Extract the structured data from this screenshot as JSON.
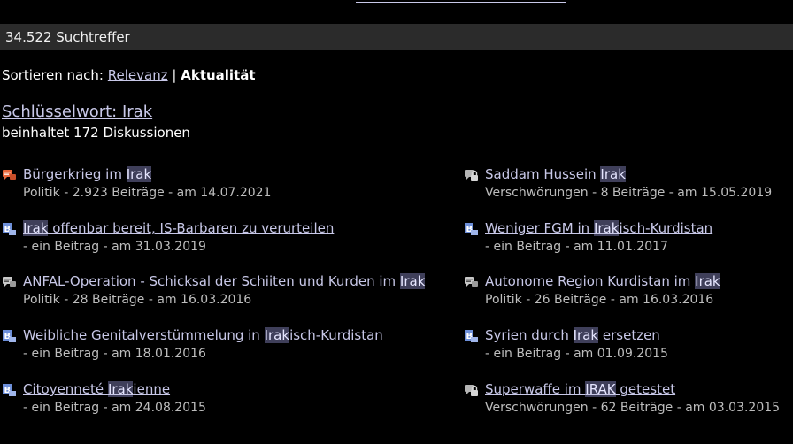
{
  "header": {
    "count_text": "34.522 Suchtreffer"
  },
  "sort": {
    "label": "Sortieren nach:",
    "relevance": "Relevanz",
    "separator": "|",
    "current": "Aktualität"
  },
  "keyword": {
    "title": "Schlüsselwort: Irak",
    "subtitle": "beinhaltet 172 Diskussionen"
  },
  "results": [
    {
      "icon": "discussion-hot-icon",
      "title_pre": "Bürgerkrieg im ",
      "title_hl": "Irak",
      "title_post": "",
      "meta": "Politik - 2.923 Beiträge - am 14.07.2021"
    },
    {
      "icon": "locked-discussion-icon",
      "title_pre": "Saddam Hussein ",
      "title_hl": "Irak",
      "title_post": "",
      "meta": "Verschwörungen - 8 Beiträge - am 15.05.2019"
    },
    {
      "icon": "blog-icon",
      "title_pre": "",
      "title_hl": "Irak",
      "title_post": " offenbar bereit, IS-Barbaren zu verurteilen",
      "meta": "- ein Beitrag - am 31.03.2019"
    },
    {
      "icon": "blog-icon",
      "title_pre": "Weniger FGM in ",
      "title_hl": "Irak",
      "title_post": "isch-Kurdistan",
      "meta": "- ein Beitrag - am 11.01.2017"
    },
    {
      "icon": "discussion-icon",
      "title_pre": "ANFAL-Operation - Schicksal der Schiiten und Kurden im ",
      "title_hl": "Irak",
      "title_post": "",
      "meta": "Politik - 28 Beiträge - am 16.03.2016"
    },
    {
      "icon": "discussion-icon",
      "title_pre": "Autonome Region Kurdistan im ",
      "title_hl": "Irak",
      "title_post": "",
      "meta": "Politik - 26 Beiträge - am 16.03.2016"
    },
    {
      "icon": "blog-icon",
      "title_pre": "Weibliche Genitalverstümmelung in ",
      "title_hl": "Irak",
      "title_post": "isch-Kurdistan",
      "meta": "- ein Beitrag - am 18.01.2016"
    },
    {
      "icon": "blog-icon",
      "title_pre": "Syrien durch ",
      "title_hl": "Irak",
      "title_post": " ersetzen",
      "meta": "- ein Beitrag - am 01.09.2015"
    },
    {
      "icon": "blog-icon",
      "title_pre": "Citoyenneté ",
      "title_hl": "Irak",
      "title_post": "ienne",
      "meta": "- ein Beitrag - am 24.08.2015"
    },
    {
      "icon": "locked-discussion-icon",
      "title_pre": "Superwaffe im ",
      "title_hl": "IRAK",
      "title_post": " getestet",
      "meta": "Verschwörungen - 62 Beiträge - am 03.03.2015"
    }
  ]
}
